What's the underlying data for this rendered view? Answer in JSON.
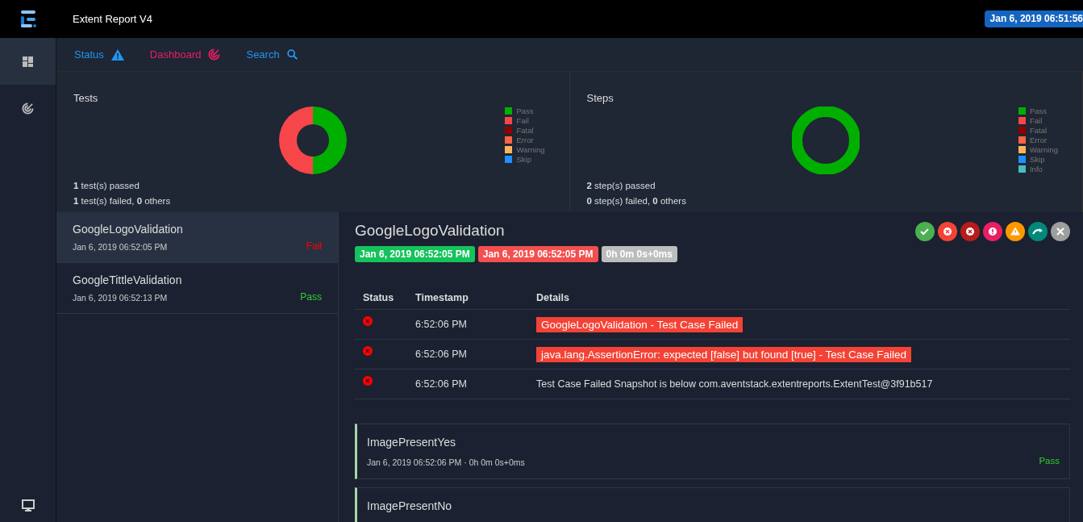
{
  "header": {
    "title": "Extent Report V4",
    "date_badge": "Jan 6, 2019 06:51:56"
  },
  "sidebar": {
    "items": [
      {
        "kind": "dashboard",
        "selected": true
      },
      {
        "kind": "radar",
        "selected": false
      }
    ]
  },
  "nav": [
    {
      "label": "Status",
      "kind": "status",
      "color": "#2196f3"
    },
    {
      "label": "Dashboard",
      "kind": "dashboard",
      "color": "#e91e63"
    },
    {
      "label": "Search",
      "kind": "search",
      "color": "#2196f3"
    }
  ],
  "cards": [
    {
      "title": "Tests",
      "kind": "split",
      "legend": [
        {
          "label": "Pass",
          "color": "#00af00"
        },
        {
          "label": "Fail",
          "color": "#f7464a"
        },
        {
          "label": "Fatal",
          "color": "#8b0000"
        },
        {
          "label": "Error",
          "color": "#ff6347"
        },
        {
          "label": "Warning",
          "color": "#fdb45c"
        },
        {
          "label": "Skip",
          "color": "#1e90ff"
        }
      ],
      "lines": [
        "**1** test(s) passed",
        "**1** test(s) failed, **0** others"
      ]
    },
    {
      "title": "Steps",
      "kind": "full",
      "legend": [
        {
          "label": "Pass",
          "color": "#00af00"
        },
        {
          "label": "Fail",
          "color": "#f7464a"
        },
        {
          "label": "Fatal",
          "color": "#8b0000"
        },
        {
          "label": "Error",
          "color": "#ff6347"
        },
        {
          "label": "Warning",
          "color": "#fdb45c"
        },
        {
          "label": "Skip",
          "color": "#1e90ff"
        },
        {
          "label": "Info",
          "color": "#46bfbd"
        }
      ],
      "lines": [
        "**2** step(s) passed",
        "**0** step(s) failed, **0** others"
      ]
    }
  ],
  "tests": [
    {
      "name": "GoogleLogoValidation",
      "time": "Jan 6, 2019 06:52:05 PM",
      "status": "Fail",
      "selected": true
    },
    {
      "name": "GoogleTittleValidation",
      "time": "Jan 6, 2019 06:52:13 PM",
      "status": "Pass",
      "selected": false
    }
  ],
  "detail": {
    "title": "GoogleLogoValidation",
    "badges": [
      {
        "text": "Jan 6, 2019 06:52:05 PM",
        "kind": "start"
      },
      {
        "text": "Jan 6, 2019 06:52:05 PM",
        "kind": "end"
      },
      {
        "text": "0h 0m 0s+0ms",
        "kind": "duration"
      }
    ],
    "filters": [
      {
        "kind": "pass"
      },
      {
        "kind": "fail"
      },
      {
        "kind": "fatal"
      },
      {
        "kind": "error"
      },
      {
        "kind": "warning"
      },
      {
        "kind": "skip"
      },
      {
        "kind": "clear"
      }
    ],
    "columns": [
      "Status",
      "Timestamp",
      "Details"
    ],
    "rows": [
      {
        "kind": "fail",
        "timestamp": "6:52:06 PM",
        "details": "GoogleLogoValidation - Test Case Failed",
        "highlight": true
      },
      {
        "kind": "fail",
        "timestamp": "6:52:06 PM",
        "details": "java.lang.AssertionError: expected [false] but found [true] - Test Case Failed",
        "highlight": true
      },
      {
        "kind": "fail",
        "timestamp": "6:52:06 PM",
        "details": "Test Case Failed Snapshot is below com.aventstack.extentreports.ExtentTest@3f91b517",
        "highlight": false
      }
    ],
    "nodes": [
      {
        "name": "ImagePresentYes",
        "meta": "Jan 6, 2019 06:52:06 PM · 0h 0m 0s+0ms",
        "status": "Pass"
      },
      {
        "name": "ImagePresentNo"
      }
    ]
  }
}
